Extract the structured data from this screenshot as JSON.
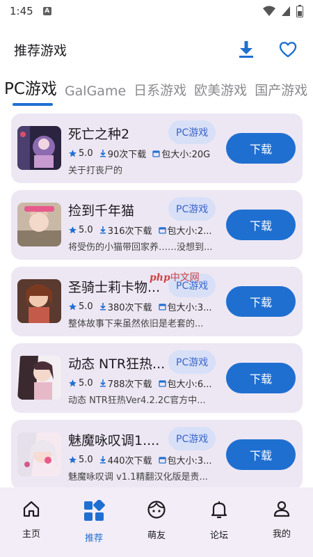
{
  "status_bar": {
    "time": "1:45",
    "notif_letter": "A"
  },
  "app_bar": {
    "title": "推荐游戏",
    "download_icon": "download-icon",
    "favorite_icon": "heart-outline-icon"
  },
  "tabs": [
    "PC游戏",
    "GalGame",
    "日系游戏",
    "欧美游戏",
    "国产游戏"
  ],
  "games": [
    {
      "name": "死亡之种2",
      "tag": "PC游戏",
      "rating": "5.0",
      "downloads": "90次下载",
      "size": "包大小:20G",
      "desc": "关于打丧尸的",
      "button": "下载"
    },
    {
      "name": "捡到千年猫",
      "tag": "PC游戏",
      "rating": "5.0",
      "downloads": "316次下载",
      "size": "包大小:2...",
      "desc": "将受伤的小猫带回家养……没想到...",
      "button": "下载"
    },
    {
      "name": "圣骑士莉卡物...",
      "tag": "PC游戏",
      "rating": "5.0",
      "downloads": "380次下载",
      "size": "包大小:3...",
      "desc": "整体故事下来虽然依旧是老套的...",
      "button": "下载"
    },
    {
      "name": "动态 NTR狂热...",
      "tag": "PC游戏",
      "rating": "5.0",
      "downloads": "788次下载",
      "size": "包大小:6...",
      "desc": "动态 NTR狂热Ver4.2.2C官方中...",
      "button": "下载"
    },
    {
      "name": "魅魔咏叹调1....",
      "tag": "PC游戏",
      "rating": "5.0",
      "downloads": "440次下载",
      "size": "包大小:3...",
      "desc": "魅魔咏叹调 v1.1精翻汉化版是责...",
      "button": "下载"
    }
  ],
  "watermark": {
    "brand": "php",
    "text": "中文网"
  },
  "bottom_nav": [
    {
      "label": "主页",
      "icon": "home-icon"
    },
    {
      "label": "推荐",
      "icon": "grid-icon"
    },
    {
      "label": "萌友",
      "icon": "face-icon"
    },
    {
      "label": "论坛",
      "icon": "bell-icon"
    },
    {
      "label": "我的",
      "icon": "person-icon"
    }
  ],
  "colors": {
    "accent": "#1f6fd1",
    "card_bg": "#ede7f3",
    "tag_bg": "#d8e0f7",
    "nav_bg": "#f2edf7"
  }
}
